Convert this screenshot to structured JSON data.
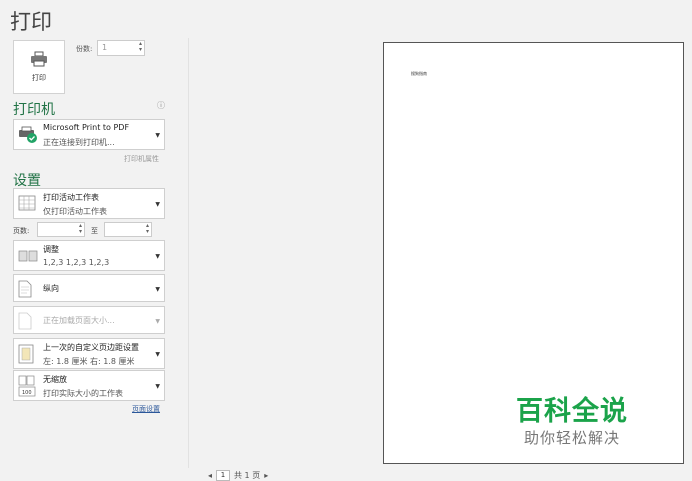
{
  "page": {
    "title": "打印",
    "print_button_label": "打印",
    "copies_label": "份数:",
    "copies_value": "1"
  },
  "printer": {
    "heading": "打印机",
    "name": "Microsoft Print to PDF",
    "status": "正在连接到打印机...",
    "properties_link": "打印机属性"
  },
  "settings": {
    "heading": "设置",
    "scope_title": "打印活动工作表",
    "scope_sub": "仅打印活动工作表",
    "pages_label": "页数:",
    "pages_to_label": "至",
    "collate_title": "调整",
    "collate_sub": "1,2,3   1,2,3   1,2,3",
    "orientation": "纵向",
    "paper_size": "正在加载页面大小...",
    "margins_title": "上一次的自定义页边距设置",
    "margins_sub": "左: 1.8 厘米    右: 1.8 厘米",
    "scaling_title": "无缩放",
    "scaling_sub": "打印实际大小的工作表",
    "page_setup_link": "页面设置"
  },
  "preview": {
    "page_text": "搜狗指南",
    "watermark_main": "百科全说",
    "watermark_sub": "助你轻松解决"
  },
  "pager": {
    "prev": "◂",
    "current": "1",
    "total": "共 1 页",
    "next": "▸"
  }
}
